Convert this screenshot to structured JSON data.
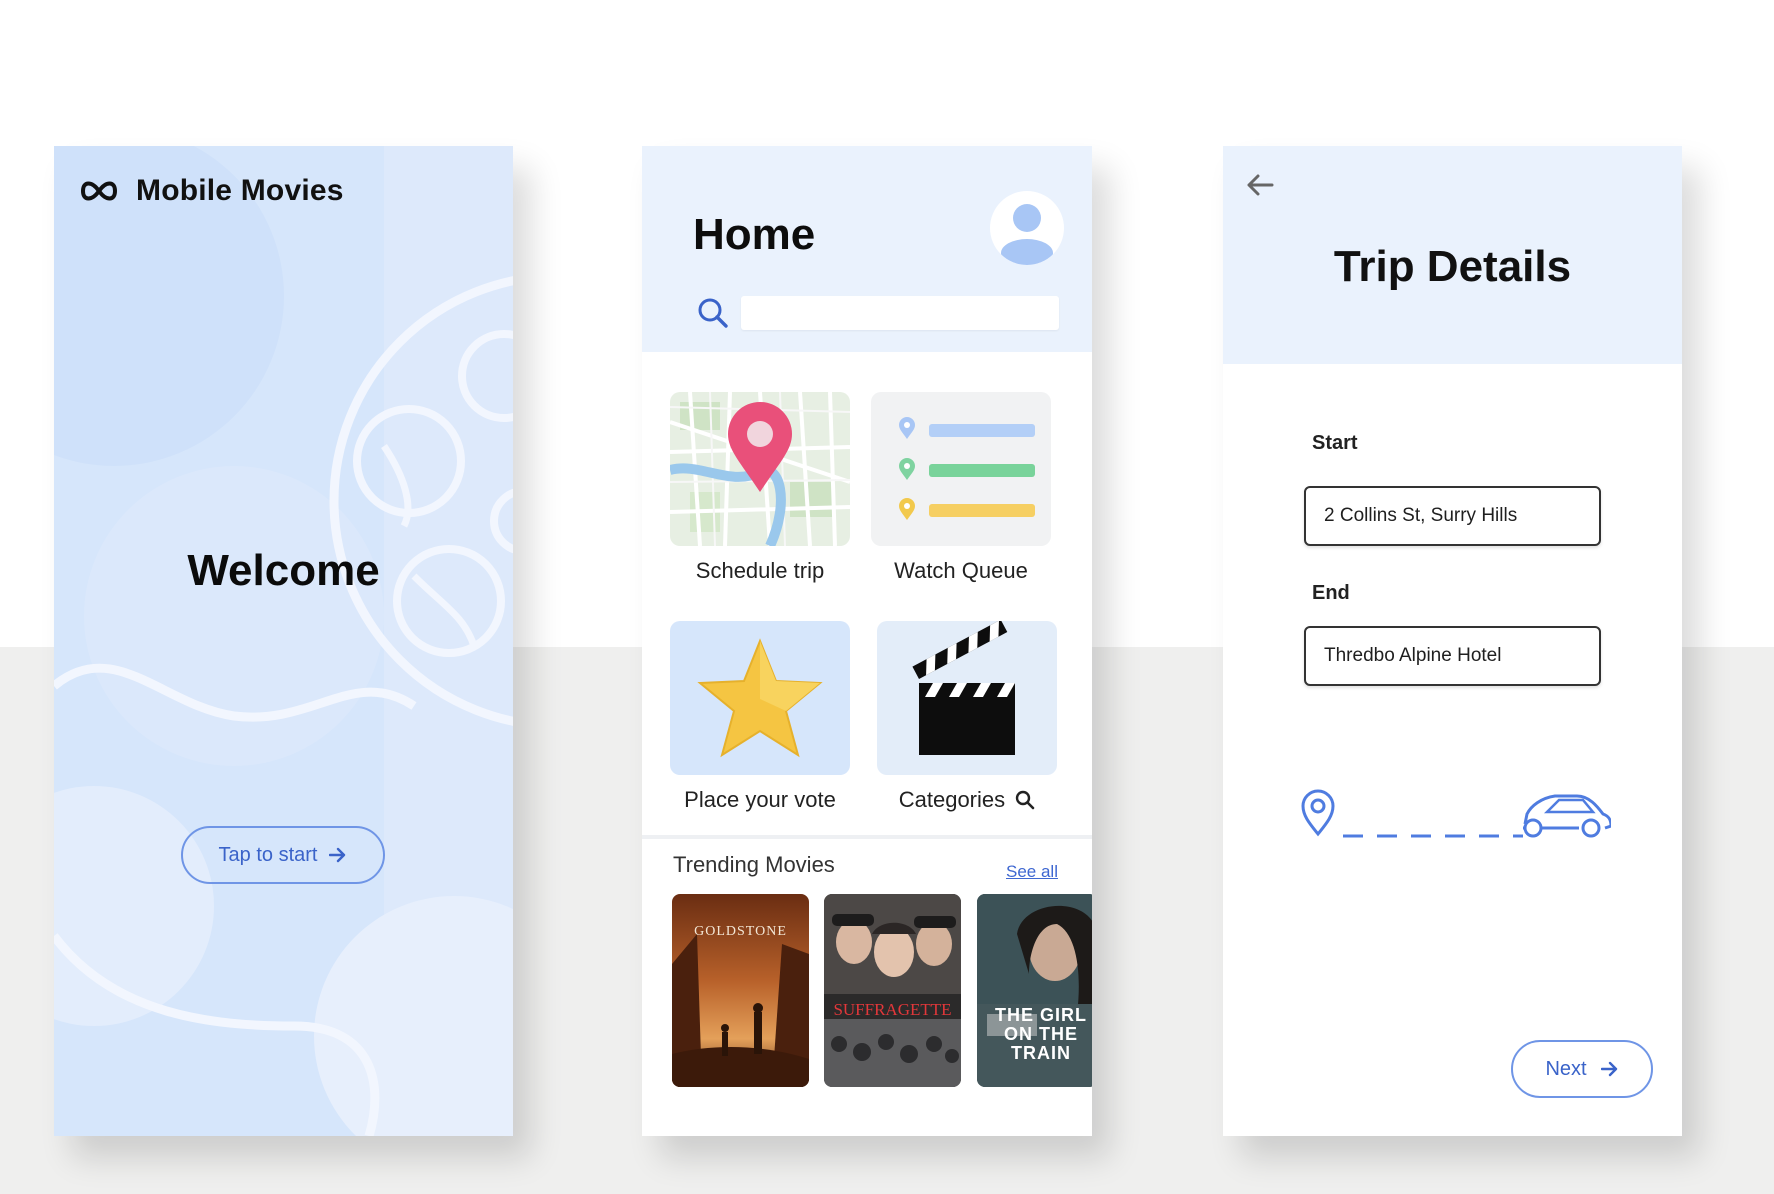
{
  "welcome_screen": {
    "brand_name": "Mobile Movies",
    "title": "Welcome",
    "start_button_label": "Tap to start"
  },
  "home_screen": {
    "title": "Home",
    "search": {
      "value": "",
      "placeholder": ""
    },
    "tiles": [
      {
        "label": "Schedule trip",
        "icon": "map-pin-icon"
      },
      {
        "label": "Watch Queue",
        "icon": "list-icon"
      },
      {
        "label": "Place your vote",
        "icon": "star-icon"
      },
      {
        "label": "Categories",
        "icon": "clapperboard-icon"
      }
    ],
    "trending": {
      "title": "Trending Movies",
      "see_all_label": "See all",
      "posters": [
        {
          "title": "GOLDSTONE"
        },
        {
          "title": "SUFFRAGETTE"
        },
        {
          "title": "THE GIRL ON THE TRAIN"
        }
      ]
    }
  },
  "trip_screen": {
    "title": "Trip Details",
    "start_label": "Start",
    "start_value": "2 Collins St, Surry Hills",
    "end_label": "End",
    "end_value": "Thredbo Alpine Hotel",
    "next_button_label": "Next"
  },
  "colors": {
    "accent": "#3a63c9",
    "header_bg": "#eaf2fd",
    "welcome_bg": "#d6e6fb",
    "pin_pink": "#e9507a",
    "star_gold": "#f5c542"
  }
}
